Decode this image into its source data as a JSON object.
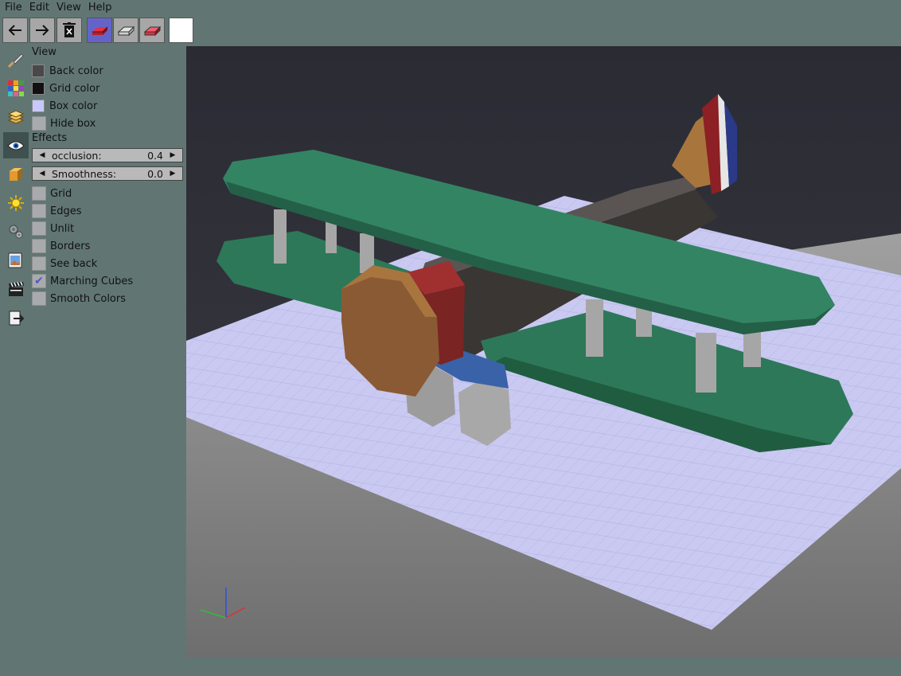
{
  "menu": [
    "File",
    "Edit",
    "View",
    "Help"
  ],
  "toolbar": {
    "undo_icon": "arrow-left-icon",
    "redo_icon": "arrow-right-icon",
    "delete_icon": "trash-icon",
    "tools": [
      "add-voxel-icon",
      "paint-voxel-icon",
      "remove-voxel-icon"
    ],
    "current_color": "#ffffff"
  },
  "sidebar_icons": [
    "brush-icon",
    "palette-icon",
    "layers-icon",
    "eye-icon",
    "cube-icon",
    "sun-icon",
    "gear-icon",
    "image-icon",
    "clapperboard-icon",
    "export-icon"
  ],
  "panel": {
    "view_title": "View",
    "colors": [
      {
        "label": "Back color",
        "color": "#494949"
      },
      {
        "label": "Grid color",
        "color": "#111111"
      },
      {
        "label": "Box color",
        "color": "#c8c8fa"
      }
    ],
    "hide_box": {
      "label": "Hide box",
      "checked": false
    },
    "effects_title": "Effects",
    "sliders": [
      {
        "label": "occlusion:",
        "value": "0.4"
      },
      {
        "label": "Smoothness:",
        "value": "0.0"
      }
    ],
    "checks": [
      {
        "label": "Grid",
        "checked": false
      },
      {
        "label": "Edges",
        "checked": false
      },
      {
        "label": "Unlit",
        "checked": false
      },
      {
        "label": "Borders",
        "checked": false
      },
      {
        "label": "See back",
        "checked": false
      },
      {
        "label": "Marching Cubes",
        "checked": true
      },
      {
        "label": "Smooth Colors",
        "checked": false
      }
    ]
  },
  "viewport": {
    "scene": "biplane-voxel-model",
    "background_top": "#2b2b34",
    "floor_color": "#c9c9f2",
    "ground_color": "#8c8c8c"
  }
}
